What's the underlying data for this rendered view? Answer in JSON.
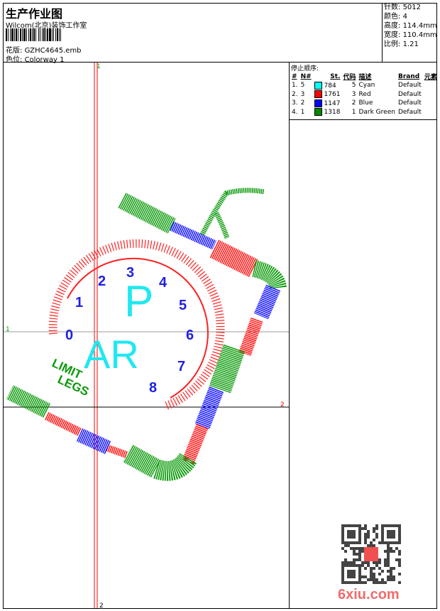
{
  "header": {
    "title": "生产作业图",
    "company": "Wilcom(北京)装饰工作室",
    "design_label": "花版:",
    "design_value": "GZHC4645.emb",
    "colorway_label": "色位:",
    "colorway_value": "Colorway 1"
  },
  "stats": [
    {
      "label": "针数:",
      "value": "5012"
    },
    {
      "label": "颜色:",
      "value": "4"
    },
    {
      "label": "高度:",
      "value": "114.4mm"
    },
    {
      "label": "宽度:",
      "value": "110.4mm"
    },
    {
      "label": "比例:",
      "value": "1.21"
    }
  ],
  "stop_sequence": {
    "title": "停止顺序:",
    "columns": [
      "#",
      "N#",
      "St.",
      "代码",
      "描述",
      "Brand",
      "元素"
    ],
    "rows": [
      {
        "idx": "1.",
        "n": "5",
        "color": "#00ffff",
        "st": "784",
        "code": "5",
        "desc": "Cyan",
        "brand": "Default"
      },
      {
        "idx": "2.",
        "n": "3",
        "color": "#ff0000",
        "st": "1761",
        "code": "3",
        "desc": "Red",
        "brand": "Default"
      },
      {
        "idx": "3.",
        "n": "2",
        "color": "#0000ff",
        "st": "1147",
        "code": "2",
        "desc": "Blue",
        "brand": "Default"
      },
      {
        "idx": "4.",
        "n": "1",
        "color": "#008800",
        "st": "1318",
        "code": "1",
        "desc": "Dark Green",
        "brand": "Default"
      }
    ]
  },
  "design": {
    "axis_labels": {
      "v_top": "1",
      "v_bottom": "2",
      "h_left": "1",
      "h_right": "2"
    },
    "dial_numbers": [
      "0",
      "1",
      "2",
      "3",
      "4",
      "5",
      "6",
      "7",
      "8"
    ],
    "big_text_1": "P",
    "big_text_2": "AR",
    "text_limit": "LIMIT",
    "text_legs": "LEGS"
  },
  "watermark": "6xiu.com"
}
